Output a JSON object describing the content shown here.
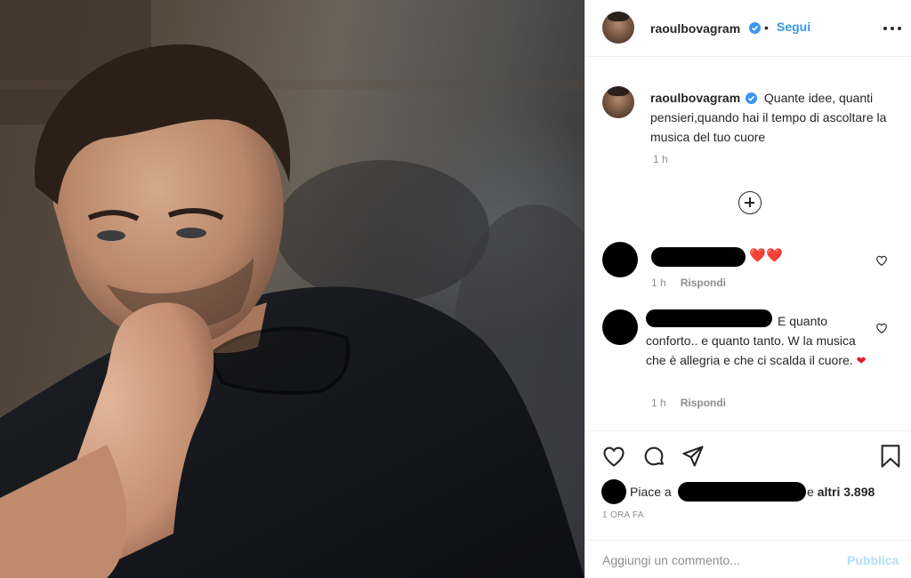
{
  "post": {
    "username": "raoulbovagram",
    "follow_label": "Segui",
    "dot_separator": "•",
    "caption_text": "Quante idee, quanti pensieri,quando hai il tempo di ascoltare la musica del tuo cuore",
    "caption_time": "1 h",
    "photo_alt": "foto"
  },
  "comments": [
    {
      "text": "",
      "hearts": "❤️",
      "time": "1 h",
      "reply_label": "Rispondi"
    },
    {
      "text": "E quanto conforto.. e quanto tanto. W la musica che è allegria e che ci scalda il cuore.",
      "heart": "❤",
      "time": "1 h",
      "reply_label": "Rispondi"
    }
  ],
  "likes": {
    "prefix": "Piace a",
    "connector": "e",
    "others": "altri 3.898"
  },
  "timestamp": "1 ORA FA",
  "comment_box": {
    "placeholder": "Aggiungi un commento...",
    "publish_label": "Pubblica"
  },
  "icons": {
    "verified": "verified-badge-icon",
    "more": "more-options-icon",
    "load_more": "plus-circle-icon",
    "like": "heart-outline-icon",
    "comment": "comment-icon",
    "share": "paper-plane-icon",
    "save": "bookmark-icon"
  },
  "colors": {
    "accent": "#3897f0",
    "publish_disabled": "#b2dffc",
    "muted_text": "#8e8e8e",
    "heart_red": "#e0192f"
  }
}
